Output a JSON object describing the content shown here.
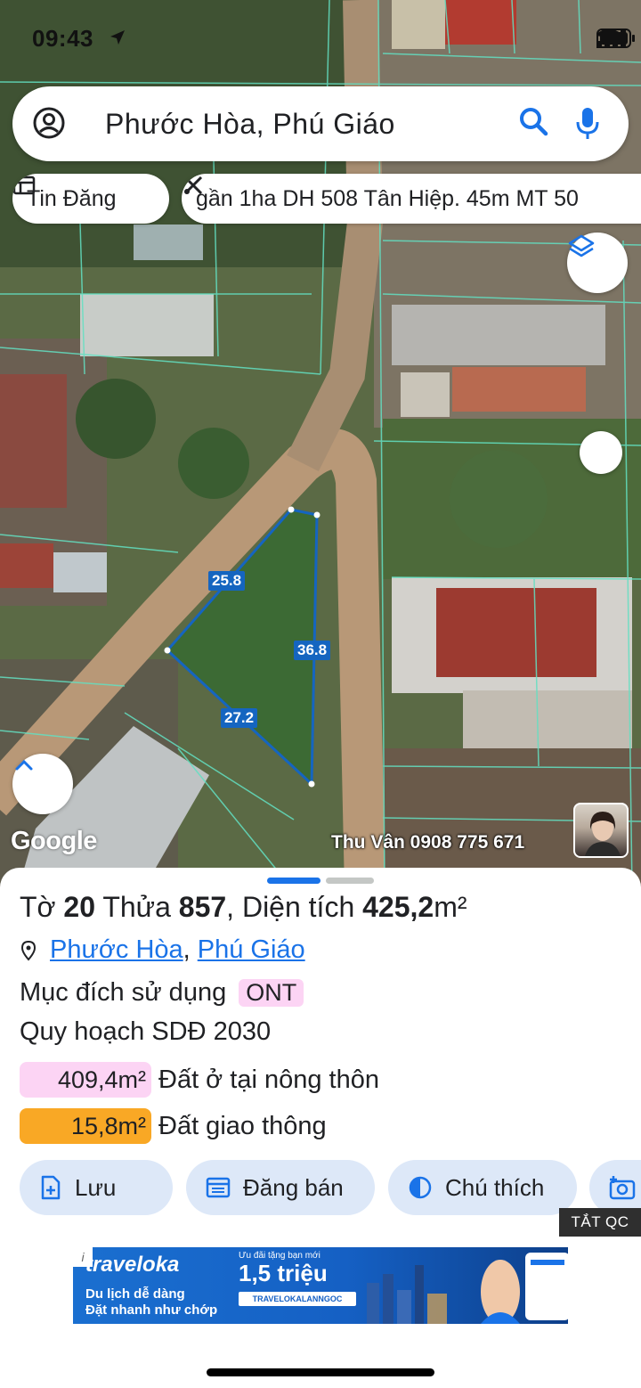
{
  "status_bar": {
    "time": "09:43"
  },
  "search": {
    "query": "Phước Hòa, Phú Giáo"
  },
  "chips": {
    "listing_label": "Tin Đăng",
    "listing_title": "gần 1ha DH 508 Tân Hiệp. 45m MT 50"
  },
  "map": {
    "measurements": {
      "side_a": "25.8",
      "side_b": "36.8",
      "side_c": "27.2"
    },
    "google_logo": "Google",
    "watermark": "Thu Vân 0908 775 671",
    "polygon_color": "#1565c0"
  },
  "parcel": {
    "sheet_prefix": "Tờ",
    "sheet_number": "20",
    "plot_prefix": "Thửa",
    "plot_number": "857",
    "area_prefix": "Diện tích",
    "area_value": "425,2",
    "area_unit": "m²",
    "ward": "Phước Hòa",
    "separator": ",",
    "district": "Phú Giáo",
    "purpose_label": "Mục đích sử dụng",
    "purpose_code": "ONT",
    "plan_label": "Quy hoạch SDĐ 2030",
    "zones": [
      {
        "area": "409,4m²",
        "label": "Đất ở tại nông thôn",
        "color": "#fcd4f4"
      },
      {
        "area": "15,8m²",
        "label": "Đất giao thông",
        "color": "#f9a825"
      }
    ]
  },
  "actions": {
    "save": "Lưu",
    "post": "Đăng bán",
    "legend": "Chú thích"
  },
  "ads": {
    "hide_label": "TẮT QC",
    "info": "i",
    "brand": "traveloka",
    "line1": "Du lịch dễ dàng",
    "line2": "Đặt nhanh như chớp",
    "promo": "Ưu đãi tặng bạn mới",
    "amount": "1,5 triệu",
    "code": "TRAVELOKALANNGOC"
  }
}
